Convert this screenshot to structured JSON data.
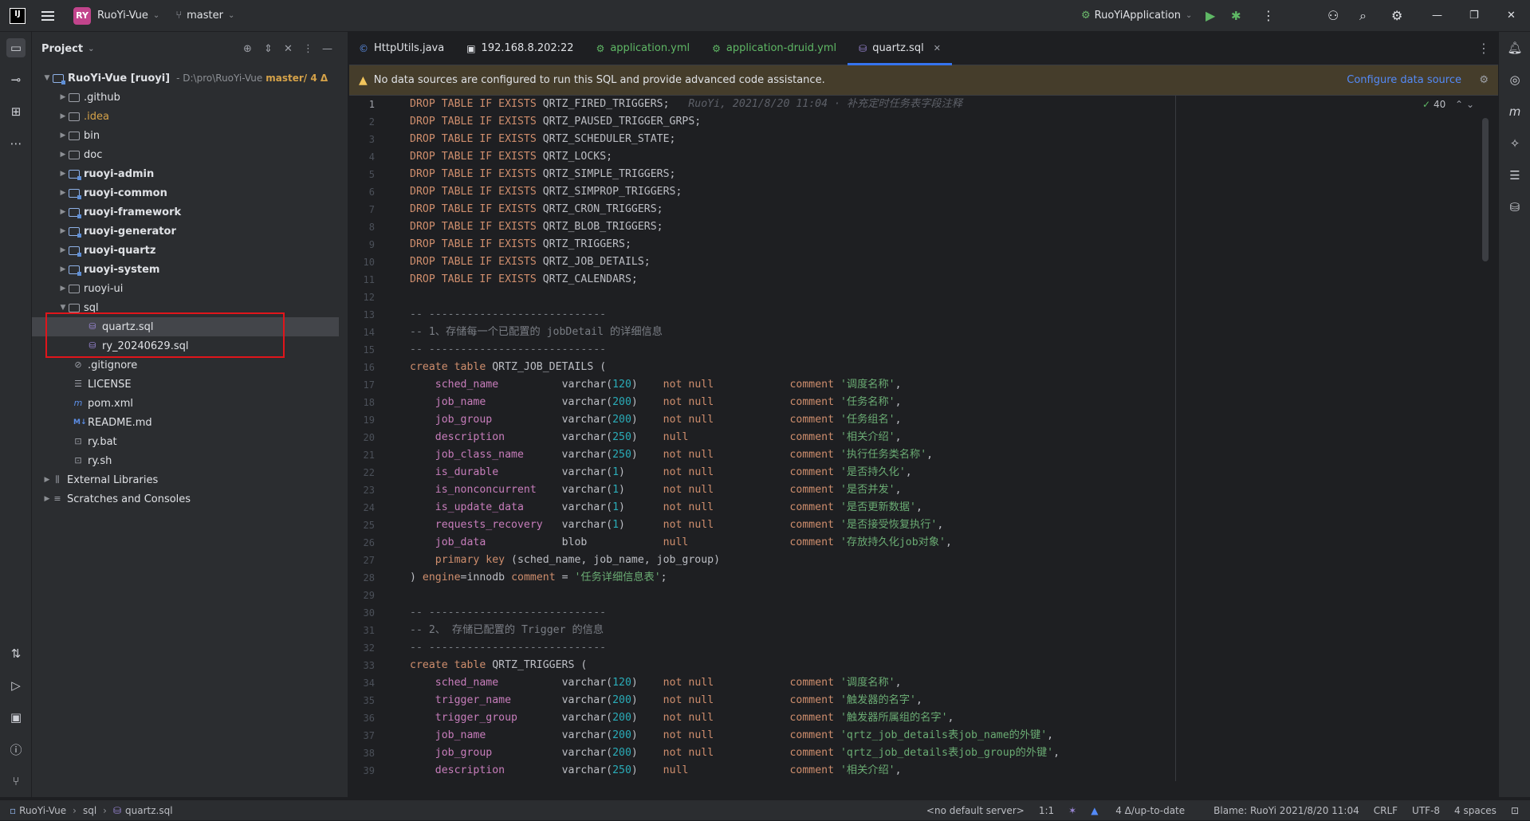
{
  "titlebar": {
    "project_badge": "RY",
    "project_name": "RuoYi-Vue",
    "branch": "master",
    "run_config": "RuoYiApplication"
  },
  "project_panel": {
    "title": "Project",
    "root": {
      "name": "RuoYi-Vue [ruoyi]",
      "path": "- D:\\pro\\RuoYi-Vue",
      "git": "master/ 4 Δ"
    },
    "items": [
      ".github",
      ".idea",
      "bin",
      "doc",
      "ruoyi-admin",
      "ruoyi-common",
      "ruoyi-framework",
      "ruoyi-generator",
      "ruoyi-quartz",
      "ruoyi-system",
      "ruoyi-ui",
      "sql",
      "quartz.sql",
      "ry_20240629.sql",
      ".gitignore",
      "LICENSE",
      "pom.xml",
      "README.md",
      "ry.bat",
      "ry.sh",
      "External Libraries",
      "Scratches and Consoles"
    ]
  },
  "tabs": [
    {
      "label": "HttpUtils.java"
    },
    {
      "label": "192.168.8.202:22"
    },
    {
      "label": "application.yml"
    },
    {
      "label": "application-druid.yml"
    },
    {
      "label": "quartz.sql"
    }
  ],
  "warning": {
    "text": "No data sources are configured to run this SQL and provide advanced code assistance.",
    "action": "Configure data source"
  },
  "editor": {
    "inspection_count": "40",
    "blame_hint": "RuoYi, 2021/8/20 11:04 · 补充定时任务表字段注释",
    "line_numbers": [
      "1",
      "2",
      "3",
      "4",
      "5",
      "6",
      "7",
      "8",
      "9",
      "10",
      "11",
      "12",
      "13",
      "14",
      "15",
      "16",
      "17",
      "18",
      "19",
      "20",
      "21",
      "22",
      "23",
      "24",
      "25",
      "26",
      "27",
      "28",
      "29",
      "30",
      "31",
      "32",
      "33",
      "34",
      "35",
      "36",
      "37",
      "38",
      "39"
    ]
  },
  "statusbar": {
    "crumb_project": "RuoYi-Vue",
    "crumb_folder": "sql",
    "crumb_file": "quartz.sql",
    "server": "<no default server>",
    "pos": "1:1",
    "vcs": "4 Δ/up-to-date",
    "blame": "Blame: RuoYi 2021/8/20 11:04",
    "eol": "CRLF",
    "enc": "UTF-8",
    "indent": "4 spaces"
  },
  "colors": {
    "accent": "#3574f0",
    "highlight_box": "#e0151b",
    "warning_bg": "#453d2b"
  }
}
